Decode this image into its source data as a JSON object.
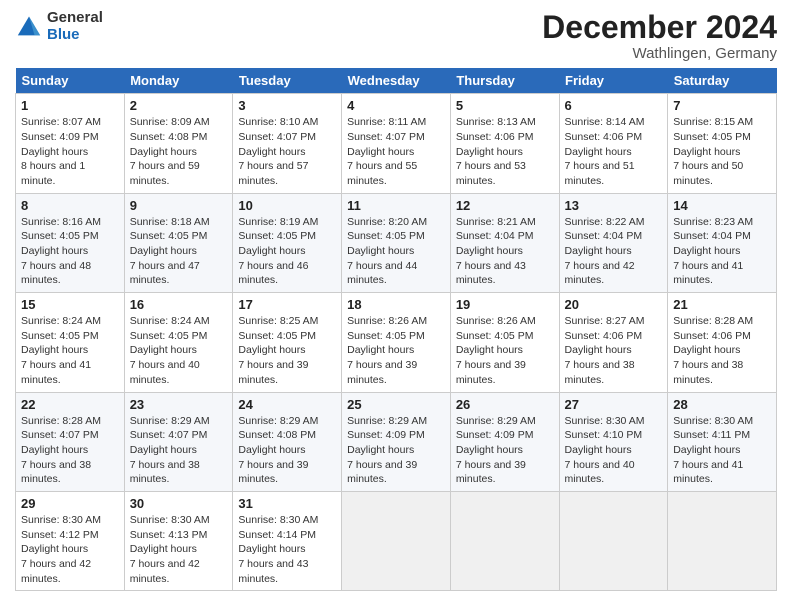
{
  "header": {
    "logo_general": "General",
    "logo_blue": "Blue",
    "month_title": "December 2024",
    "location": "Wathlingen, Germany"
  },
  "weekdays": [
    "Sunday",
    "Monday",
    "Tuesday",
    "Wednesday",
    "Thursday",
    "Friday",
    "Saturday"
  ],
  "weeks": [
    [
      {
        "day": "1",
        "sunrise": "8:07 AM",
        "sunset": "4:09 PM",
        "daylight": "8 hours and 1 minute."
      },
      {
        "day": "2",
        "sunrise": "8:09 AM",
        "sunset": "4:08 PM",
        "daylight": "7 hours and 59 minutes."
      },
      {
        "day": "3",
        "sunrise": "8:10 AM",
        "sunset": "4:07 PM",
        "daylight": "7 hours and 57 minutes."
      },
      {
        "day": "4",
        "sunrise": "8:11 AM",
        "sunset": "4:07 PM",
        "daylight": "7 hours and 55 minutes."
      },
      {
        "day": "5",
        "sunrise": "8:13 AM",
        "sunset": "4:06 PM",
        "daylight": "7 hours and 53 minutes."
      },
      {
        "day": "6",
        "sunrise": "8:14 AM",
        "sunset": "4:06 PM",
        "daylight": "7 hours and 51 minutes."
      },
      {
        "day": "7",
        "sunrise": "8:15 AM",
        "sunset": "4:05 PM",
        "daylight": "7 hours and 50 minutes."
      }
    ],
    [
      {
        "day": "8",
        "sunrise": "8:16 AM",
        "sunset": "4:05 PM",
        "daylight": "7 hours and 48 minutes."
      },
      {
        "day": "9",
        "sunrise": "8:18 AM",
        "sunset": "4:05 PM",
        "daylight": "7 hours and 47 minutes."
      },
      {
        "day": "10",
        "sunrise": "8:19 AM",
        "sunset": "4:05 PM",
        "daylight": "7 hours and 46 minutes."
      },
      {
        "day": "11",
        "sunrise": "8:20 AM",
        "sunset": "4:05 PM",
        "daylight": "7 hours and 44 minutes."
      },
      {
        "day": "12",
        "sunrise": "8:21 AM",
        "sunset": "4:04 PM",
        "daylight": "7 hours and 43 minutes."
      },
      {
        "day": "13",
        "sunrise": "8:22 AM",
        "sunset": "4:04 PM",
        "daylight": "7 hours and 42 minutes."
      },
      {
        "day": "14",
        "sunrise": "8:23 AM",
        "sunset": "4:04 PM",
        "daylight": "7 hours and 41 minutes."
      }
    ],
    [
      {
        "day": "15",
        "sunrise": "8:24 AM",
        "sunset": "4:05 PM",
        "daylight": "7 hours and 41 minutes."
      },
      {
        "day": "16",
        "sunrise": "8:24 AM",
        "sunset": "4:05 PM",
        "daylight": "7 hours and 40 minutes."
      },
      {
        "day": "17",
        "sunrise": "8:25 AM",
        "sunset": "4:05 PM",
        "daylight": "7 hours and 39 minutes."
      },
      {
        "day": "18",
        "sunrise": "8:26 AM",
        "sunset": "4:05 PM",
        "daylight": "7 hours and 39 minutes."
      },
      {
        "day": "19",
        "sunrise": "8:26 AM",
        "sunset": "4:05 PM",
        "daylight": "7 hours and 39 minutes."
      },
      {
        "day": "20",
        "sunrise": "8:27 AM",
        "sunset": "4:06 PM",
        "daylight": "7 hours and 38 minutes."
      },
      {
        "day": "21",
        "sunrise": "8:28 AM",
        "sunset": "4:06 PM",
        "daylight": "7 hours and 38 minutes."
      }
    ],
    [
      {
        "day": "22",
        "sunrise": "8:28 AM",
        "sunset": "4:07 PM",
        "daylight": "7 hours and 38 minutes."
      },
      {
        "day": "23",
        "sunrise": "8:29 AM",
        "sunset": "4:07 PM",
        "daylight": "7 hours and 38 minutes."
      },
      {
        "day": "24",
        "sunrise": "8:29 AM",
        "sunset": "4:08 PM",
        "daylight": "7 hours and 39 minutes."
      },
      {
        "day": "25",
        "sunrise": "8:29 AM",
        "sunset": "4:09 PM",
        "daylight": "7 hours and 39 minutes."
      },
      {
        "day": "26",
        "sunrise": "8:29 AM",
        "sunset": "4:09 PM",
        "daylight": "7 hours and 39 minutes."
      },
      {
        "day": "27",
        "sunrise": "8:30 AM",
        "sunset": "4:10 PM",
        "daylight": "7 hours and 40 minutes."
      },
      {
        "day": "28",
        "sunrise": "8:30 AM",
        "sunset": "4:11 PM",
        "daylight": "7 hours and 41 minutes."
      }
    ],
    [
      {
        "day": "29",
        "sunrise": "8:30 AM",
        "sunset": "4:12 PM",
        "daylight": "7 hours and 42 minutes."
      },
      {
        "day": "30",
        "sunrise": "8:30 AM",
        "sunset": "4:13 PM",
        "daylight": "7 hours and 42 minutes."
      },
      {
        "day": "31",
        "sunrise": "8:30 AM",
        "sunset": "4:14 PM",
        "daylight": "7 hours and 43 minutes."
      },
      null,
      null,
      null,
      null
    ]
  ],
  "labels": {
    "sunrise": "Sunrise:",
    "sunset": "Sunset:",
    "daylight": "Daylight hours"
  }
}
